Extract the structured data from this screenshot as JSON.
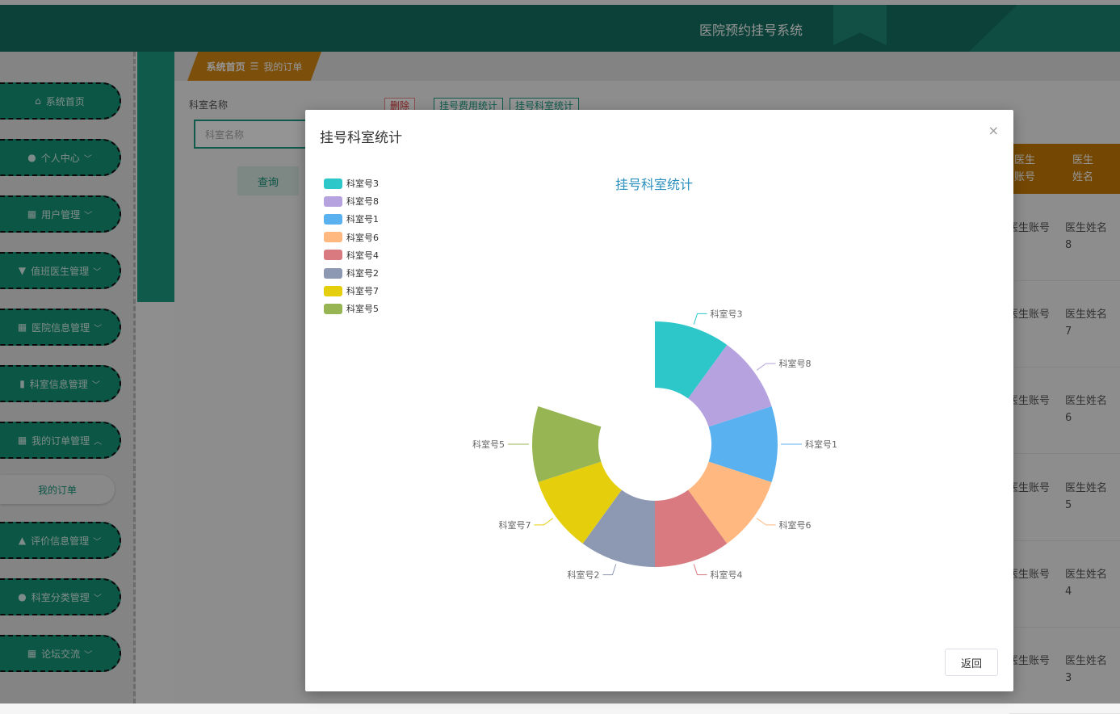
{
  "app": {
    "title": "医院预约挂号系统"
  },
  "breadcrumb": {
    "home": "系统首页",
    "separator": "☰",
    "current": "我的订单"
  },
  "sidebar": {
    "items": [
      {
        "label": "系统首页",
        "icon": "home-icon",
        "glyph": "⌂",
        "chevron": ""
      },
      {
        "label": "个人中心",
        "icon": "user-icon",
        "glyph": "●",
        "chevron": "v"
      },
      {
        "label": "用户管理",
        "icon": "grid-icon",
        "glyph": "▦",
        "chevron": "v"
      },
      {
        "label": "值班医生管理",
        "icon": "pin-icon",
        "glyph": "▼",
        "chevron": "v"
      },
      {
        "label": "医院信息管理",
        "icon": "grid-icon",
        "glyph": "▦",
        "chevron": "v"
      },
      {
        "label": "科室信息管理",
        "icon": "chart-icon",
        "glyph": "▮",
        "chevron": "v"
      },
      {
        "label": "我的订单管理",
        "icon": "grid-icon",
        "glyph": "▦",
        "chevron": "^"
      },
      {
        "label": "评价信息管理",
        "icon": "thumb-icon",
        "glyph": "▲",
        "chevron": "v"
      },
      {
        "label": "科室分类管理",
        "icon": "user-icon",
        "glyph": "●",
        "chevron": "v"
      },
      {
        "label": "论坛交流",
        "icon": "table-icon",
        "glyph": "▦",
        "chevron": "v"
      }
    ],
    "submenu_label": "我的订单"
  },
  "search": {
    "label": "科室名称",
    "placeholder": "科室名称",
    "button": "查询"
  },
  "toolbar": {
    "delete": "删除",
    "fee_stats": "挂号费用统计",
    "dept_stats": "挂号科室统计"
  },
  "table": {
    "headers": [
      "医生账号",
      "医生姓名"
    ],
    "rows": [
      {
        "account": "医生账号",
        "name": "医生姓名8"
      },
      {
        "account": "医生账号",
        "name": "医生姓名7"
      },
      {
        "account": "医生账号",
        "name": "医生姓名6"
      },
      {
        "account": "医生账号",
        "name": "医生姓名5"
      },
      {
        "account": "医生账号",
        "name": "医生姓名4"
      },
      {
        "account": "医生账号",
        "name": "医生姓名3"
      }
    ]
  },
  "modal": {
    "title": "挂号科室统计",
    "close": "×",
    "return_label": "返回"
  },
  "chart_data": {
    "type": "pie",
    "title": "挂号科室统计",
    "legend_position": "top-left",
    "style": "rose-donut",
    "slices": [
      {
        "name": "科室号3",
        "value": 1,
        "color": "#2ec7c9"
      },
      {
        "name": "科室号8",
        "value": 1,
        "color": "#b6a2de"
      },
      {
        "name": "科室号1",
        "value": 1,
        "color": "#5ab1ef"
      },
      {
        "name": "科室号6",
        "value": 1,
        "color": "#ffb980"
      },
      {
        "name": "科室号4",
        "value": 1,
        "color": "#d87a80"
      },
      {
        "name": "科室号2",
        "value": 1,
        "color": "#8d98b3"
      },
      {
        "name": "科室号7",
        "value": 1,
        "color": "#e5cf0d"
      },
      {
        "name": "科室号5",
        "value": 1,
        "color": "#97b552"
      }
    ]
  }
}
